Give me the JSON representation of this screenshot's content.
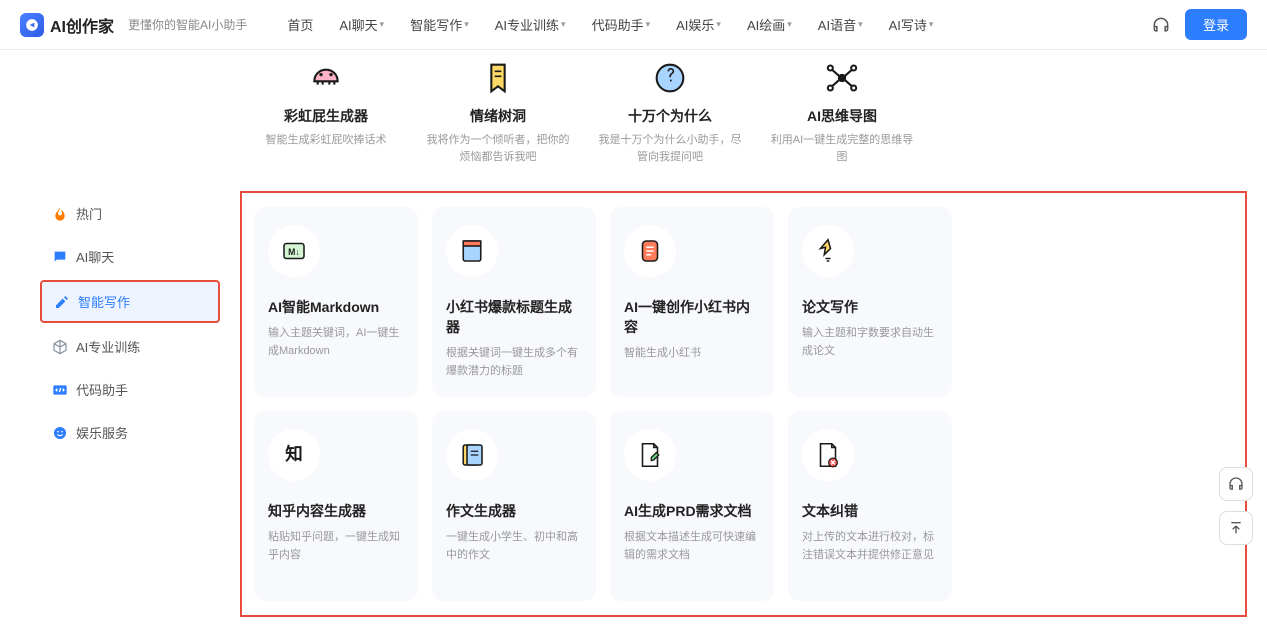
{
  "header": {
    "brand": "AI创作家",
    "tagline": "更懂你的智能AI小助手",
    "nav": [
      "首页",
      "AI聊天",
      "智能写作",
      "AI专业训练",
      "代码助手",
      "AI娱乐",
      "AI绘画",
      "AI语音",
      "AI写诗"
    ],
    "nav_has_chev": [
      false,
      true,
      true,
      true,
      true,
      true,
      true,
      true,
      true
    ],
    "login": "登录"
  },
  "sidebar": {
    "items": [
      {
        "label": "热门",
        "icon": "fire",
        "color": "#ff7a00"
      },
      {
        "label": "AI聊天",
        "icon": "chat",
        "color": "#2d7dff"
      },
      {
        "label": "智能写作",
        "icon": "edit",
        "color": "#2d7dff",
        "active": true,
        "boxed": true
      },
      {
        "label": "AI专业训练",
        "icon": "cube",
        "color": "#8892a0"
      },
      {
        "label": "代码助手",
        "icon": "code",
        "color": "#2d7dff"
      },
      {
        "label": "娱乐服务",
        "icon": "smile",
        "color": "#2d7dff"
      }
    ]
  },
  "top_cards": [
    {
      "title": "彩虹屁生成器",
      "desc": "智能生成彩虹屁吹捧话术"
    },
    {
      "title": "情绪树洞",
      "desc": "我将作为一个倾听者，把你的烦恼都告诉我吧"
    },
    {
      "title": "十万个为什么",
      "desc": "我是十万个为什么小助手，尽管向我提问吧"
    },
    {
      "title": "AI思维导图",
      "desc": "利用AI一键生成完整的思维导图"
    }
  ],
  "grid_cards": [
    {
      "title": "AI智能Markdown",
      "desc": "输入主题关键词，AI一键生成Markdown"
    },
    {
      "title": "小红书爆款标题生成器",
      "desc": "根据关键词一键生成多个有爆款潜力的标题"
    },
    {
      "title": "AI一键创作小红书内容",
      "desc": "智能生成小红书"
    },
    {
      "title": "论文写作",
      "desc": "输入主题和字数要求自动生成论文"
    },
    {
      "title": "知乎内容生成器",
      "desc": "粘贴知乎问题，一键生成知乎内容"
    },
    {
      "title": "作文生成器",
      "desc": "一键生成小学生、初中和高中的作文"
    },
    {
      "title": "AI生成PRD需求文档",
      "desc": "根据文本描述生成可快速编辑的需求文档"
    },
    {
      "title": "文本纠错",
      "desc": "对上传的文本进行校对，标注错误文本并提供修正意见"
    }
  ]
}
